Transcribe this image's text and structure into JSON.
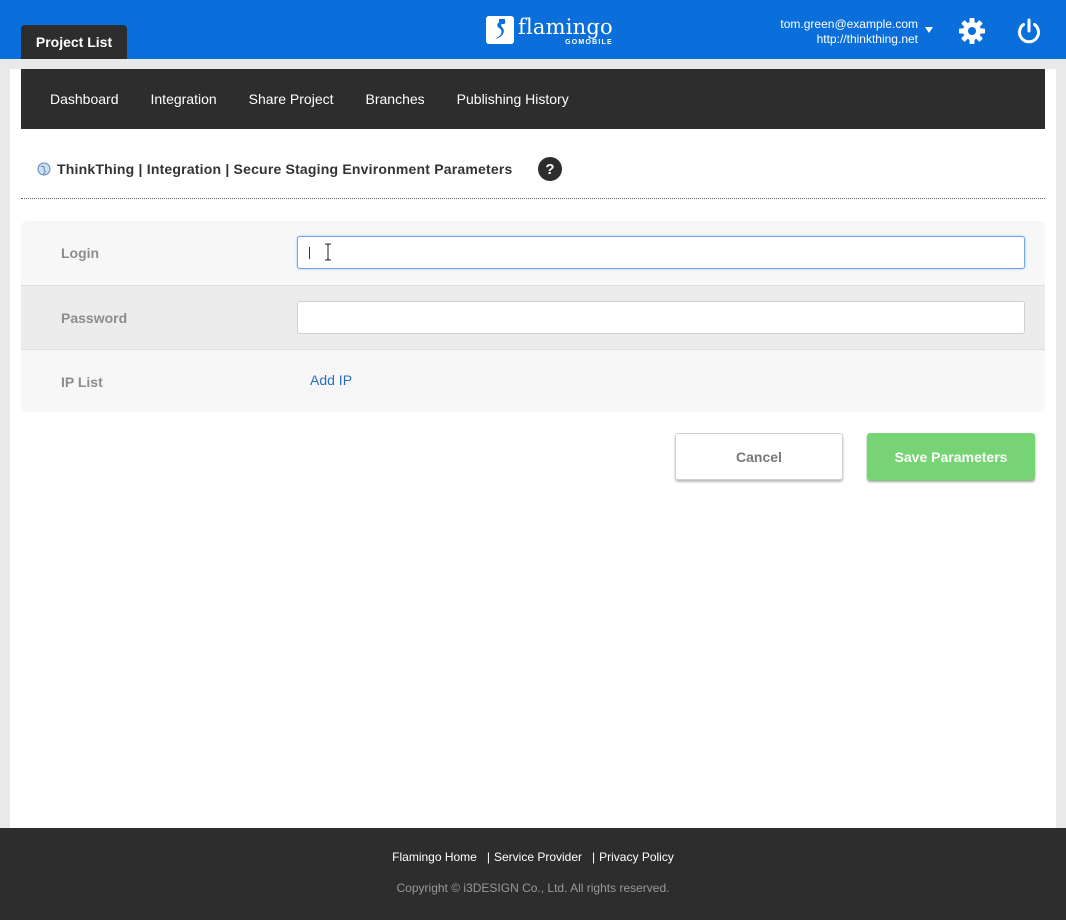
{
  "header": {
    "project_list_tab": "Project List",
    "logo_word": "flamingo",
    "logo_sub": "GOMOBILE",
    "account_email": "tom.green@example.com",
    "account_url": "http://thinkthing.net"
  },
  "nav": {
    "items": [
      "Dashboard",
      "Integration",
      "Share Project",
      "Branches",
      "Publishing History"
    ]
  },
  "breadcrumb": {
    "text": "ThinkThing | Integration | Secure Staging Environment Parameters",
    "help": "?"
  },
  "form": {
    "login_label": "Login",
    "login_value": "",
    "password_label": "Password",
    "password_value": "",
    "ip_list_label": "IP List",
    "add_ip_link": "Add IP"
  },
  "actions": {
    "cancel_label": "Cancel",
    "save_label": "Save Parameters"
  },
  "footer": {
    "links": [
      "Flamingo Home",
      "Service Provider",
      "Privacy Policy"
    ],
    "copyright": "Copyright © i3DESIGN Co., Ltd. All rights reserved."
  },
  "colors": {
    "header_blue": "#0a6fdb",
    "dark_bar": "#2d2d2d",
    "save_green": "#76d474",
    "link_blue": "#2a6ebd"
  },
  "icons": [
    "flamingo-logo-icon",
    "chevron-down-icon",
    "gear-icon",
    "power-icon",
    "globe-icon",
    "help-icon"
  ]
}
